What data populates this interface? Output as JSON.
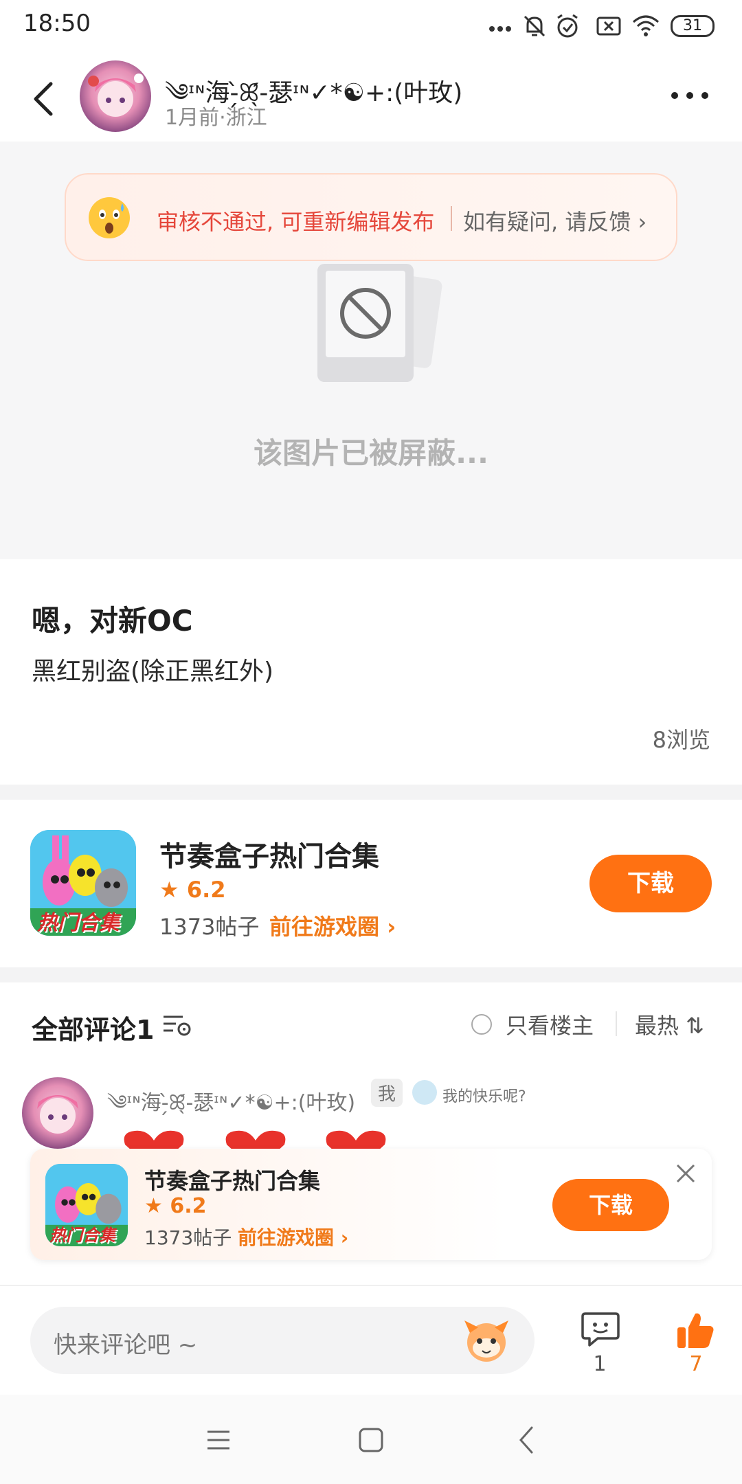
{
  "status_bar": {
    "time": "18:50",
    "battery": "31",
    "icons": [
      "more-dots-icon",
      "mute-bell-icon",
      "alarm-icon",
      "close-box-icon",
      "wifi-icon",
      "battery-icon"
    ]
  },
  "header": {
    "author_name": "༄ᶦᶰ海-̗̀ꕤ̖́-瑟ᶦᶰ✓*☯+:(叶玫)",
    "meta": "1月前·浙江"
  },
  "media": {
    "review_status": "审核不通过, 可重新编辑发布",
    "feedback": "如有疑问, 请反馈 ›",
    "blocked_text": "该图片已被屏蔽..."
  },
  "post": {
    "title": "嗯，对新OC",
    "body": "黑红别盗(除正黑红外)",
    "views": "8浏览"
  },
  "app_card": {
    "name": "节奏盒子热门合集",
    "rating": "★ 6.2",
    "posts": "1373帖子",
    "goto": "前往游戏圈 ›",
    "download": "下载",
    "icon_text": "热门合集"
  },
  "comments": {
    "title": "全部评论1",
    "only_op": "只看楼主",
    "sort": "最热 ⇅",
    "first": {
      "author": "༄ᶦᶰ海-̗̀ꕤ̖́-瑟ᶦᶰ✓*☯+:(叶玫)",
      "me_badge": "我",
      "badge_text": "我的快乐呢?"
    }
  },
  "float_card": {
    "name": "节奏盒子热门合集",
    "rating": "★ 6.2",
    "posts": "1373帖子",
    "goto": "前往游戏圈 ›",
    "download": "下载",
    "icon_text": "热门合集"
  },
  "bottom_bar": {
    "placeholder": "快来评论吧 ~",
    "comment_count": "1",
    "like_count": "7"
  },
  "colors": {
    "accent": "#ff7112",
    "warning": "#e5473b"
  }
}
